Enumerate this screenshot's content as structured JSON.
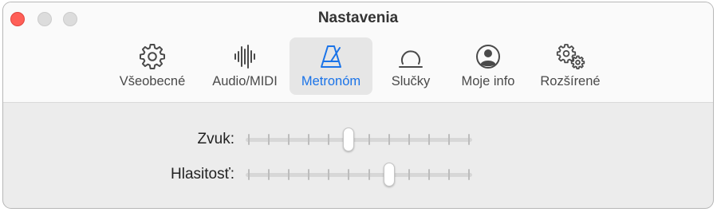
{
  "window": {
    "title": "Nastavenia"
  },
  "tabs": [
    {
      "label": "Všeobecné",
      "icon": "gear-icon",
      "selected": false
    },
    {
      "label": "Audio/MIDI",
      "icon": "waveform-icon",
      "selected": false
    },
    {
      "label": "Metronóm",
      "icon": "metronome-icon",
      "selected": true
    },
    {
      "label": "Slučky",
      "icon": "loop-icon",
      "selected": false
    },
    {
      "label": "Moje info",
      "icon": "person-icon",
      "selected": false
    },
    {
      "label": "Rozšírené",
      "icon": "gears-icon",
      "selected": false
    }
  ],
  "settings": {
    "sound": {
      "label": "Zvuk:",
      "tick_count": 12,
      "value_index": 5
    },
    "volume": {
      "label": "Hlasitosť:",
      "tick_count": 12,
      "value_index": 7
    }
  },
  "colors": {
    "accent": "#1a73e8",
    "close": "#ff5f57",
    "icon": "#4a4a4a"
  }
}
